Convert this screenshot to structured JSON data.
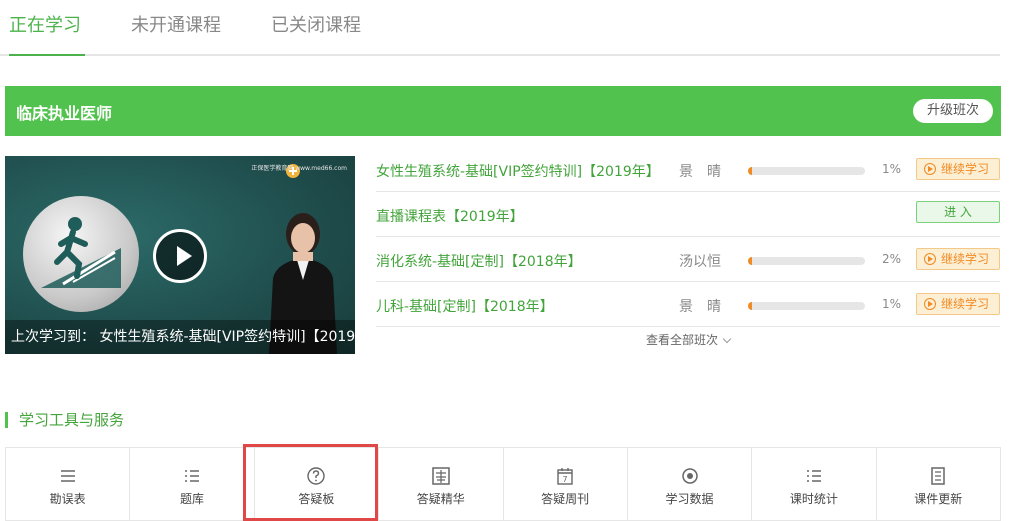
{
  "tabs": [
    {
      "label": "正在学习",
      "active": true
    },
    {
      "label": "未开通课程",
      "active": false
    },
    {
      "label": "已关闭课程",
      "active": false
    }
  ],
  "course_bar": {
    "title": "临床执业医师",
    "upgrade_label": "升级班次"
  },
  "video": {
    "caption": "上次学习到： 女性生殖系统-基础[VIP签约特训]【2019",
    "logo_text": "正保医学教育网 www.med66.com"
  },
  "courses": [
    {
      "name": "女性生殖系统-基础[VIP签约特训]【2019年】",
      "teacher": "景　晴",
      "progress": 1,
      "pct_label": "1%",
      "action": "继续学习",
      "action_type": "continue"
    },
    {
      "name": "直播课程表【2019年】",
      "teacher": "",
      "progress": null,
      "pct_label": "",
      "action": "进 入",
      "action_type": "enter"
    },
    {
      "name": "消化系统-基础[定制]【2018年】",
      "teacher": "汤以恒",
      "progress": 2,
      "pct_label": "2%",
      "action": "继续学习",
      "action_type": "continue"
    },
    {
      "name": "儿科-基础[定制]【2018年】",
      "teacher": "景　晴",
      "progress": 1,
      "pct_label": "1%",
      "action": "继续学习",
      "action_type": "continue"
    }
  ],
  "view_all_label": "查看全部班次",
  "tools_title": "学习工具与服务",
  "tools": [
    {
      "label": "勘误表",
      "icon": "menu-lines-icon"
    },
    {
      "label": "题库",
      "icon": "list-icon"
    },
    {
      "label": "答疑板",
      "icon": "question-circle-icon"
    },
    {
      "label": "答疑精华",
      "icon": "book-icon"
    },
    {
      "label": "答疑周刊",
      "icon": "calendar-icon"
    },
    {
      "label": "学习数据",
      "icon": "target-icon"
    },
    {
      "label": "课时统计",
      "icon": "list-icon"
    },
    {
      "label": "课件更新",
      "icon": "document-icon"
    }
  ],
  "colors": {
    "brand_green": "#52c24e",
    "text_green": "#43a43b",
    "progress_orange": "#f08a24",
    "highlight_red": "#e04848"
  }
}
